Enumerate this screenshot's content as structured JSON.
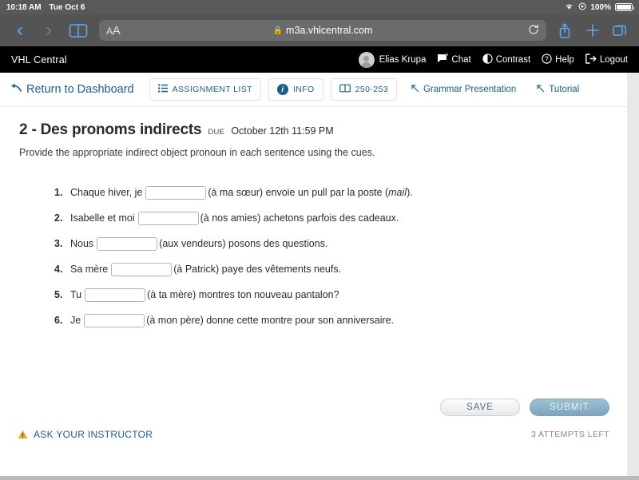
{
  "status_bar": {
    "time": "10:18 AM",
    "date": "Tue Oct 6",
    "battery_percent": "100%",
    "wifi_icon": "wifi-icon",
    "battery_icon": "battery-icon",
    "location_icon": "location-arrow-icon"
  },
  "browser": {
    "back_icon": "chevron-left-icon",
    "forward_icon": "chevron-right-icon",
    "bookmarks_icon": "book-icon",
    "text_size_label": "AA",
    "lock_icon": "lock-icon",
    "url": "m3a.vhlcentral.com",
    "reload_icon": "reload-icon",
    "share_icon": "share-icon",
    "new_tab_icon": "plus-icon",
    "tabs_icon": "tabs-icon"
  },
  "site_nav": {
    "brand": "VHL Central",
    "avatar_icon": "user-avatar-icon",
    "user_name": "Elias Krupa",
    "items": [
      {
        "label": "Chat",
        "icon": "chat-bubble-icon"
      },
      {
        "label": "Contrast",
        "icon": "contrast-circle-icon"
      },
      {
        "label": "Help",
        "icon": "question-circle-icon"
      },
      {
        "label": "Logout",
        "icon": "logout-arrow-icon"
      }
    ]
  },
  "assignment_toolbar": {
    "return_label": "Return to Dashboard",
    "return_icon": "back-arrow-icon",
    "assignment_list_label": "ASSIGNMENT LIST",
    "assignment_list_icon": "list-icon",
    "info_label": "INFO",
    "info_icon": "info-circle-icon",
    "pages_label": "250-253",
    "pages_icon": "book-open-icon",
    "grammar_label": "Grammar Presentation",
    "grammar_icon": "external-link-arrow-icon",
    "tutorial_label": "Tutorial",
    "tutorial_icon": "external-link-arrow-icon"
  },
  "activity": {
    "title": "2 - Des pronoms indirects",
    "due_label": "DUE",
    "due_value": "October 12th 11:59 PM",
    "instructions": "Provide the appropriate indirect object pronoun in each sentence using the cues.",
    "questions": [
      {
        "number": "1.",
        "pre": "Chaque hiver, je",
        "answer": "",
        "post": "(à ma sœur) envoie un pull par la poste (",
        "italic": "mail",
        "post2": ")."
      },
      {
        "number": "2.",
        "pre": "Isabelle et moi",
        "answer": "",
        "post": "(à nos amies) achetons parfois des cadeaux.",
        "italic": "",
        "post2": ""
      },
      {
        "number": "3.",
        "pre": "Nous",
        "answer": "",
        "post": "(aux vendeurs) posons des questions.",
        "italic": "",
        "post2": ""
      },
      {
        "number": "4.",
        "pre": "Sa mère",
        "answer": "",
        "post": "(à Patrick) paye des vêtements neufs.",
        "italic": "",
        "post2": ""
      },
      {
        "number": "5.",
        "pre": "Tu",
        "answer": "",
        "post": "(à ta mère) montres ton nouveau pantalon?",
        "italic": "",
        "post2": ""
      },
      {
        "number": "6.",
        "pre": "Je",
        "answer": "",
        "post": "(à mon père) donne cette montre pour son anniversaire.",
        "italic": "",
        "post2": ""
      }
    ]
  },
  "footer": {
    "save_label": "SAVE",
    "submit_label": "SUBMIT",
    "ask_instructor_label": "ASK YOUR INSTRUCTOR",
    "warning_icon": "warning-triangle-icon",
    "attempts_left": "3 ATTEMPTS LEFT"
  },
  "colors": {
    "brand_blue": "#1c5d8c",
    "submit_blue": "#7ba5bd",
    "warning_amber": "#f0a830",
    "nav_black": "#000000"
  }
}
